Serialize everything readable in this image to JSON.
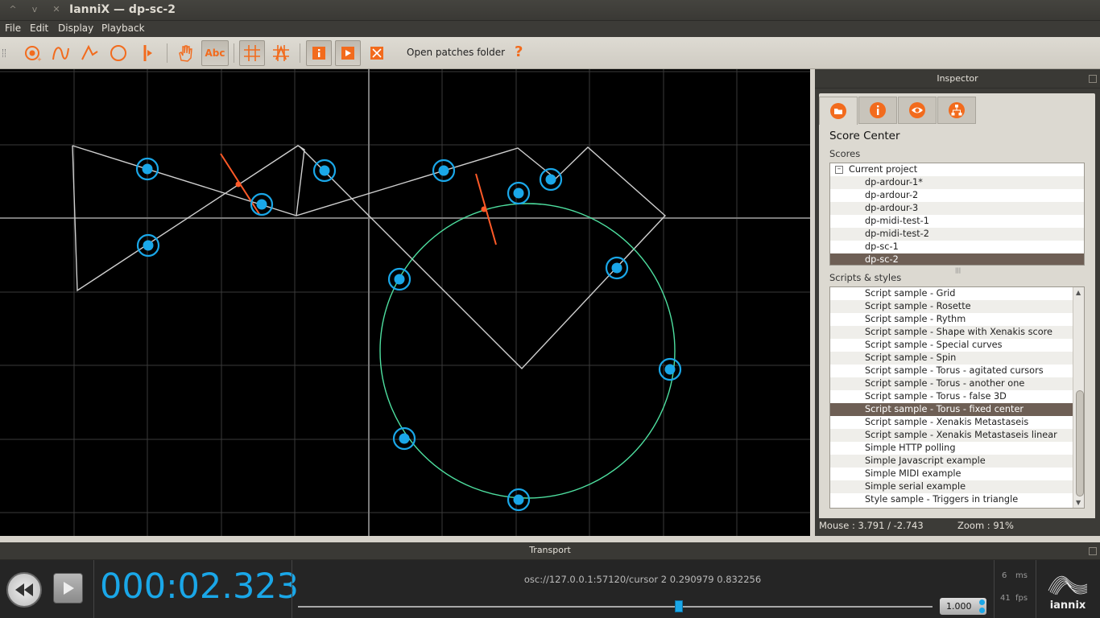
{
  "window": {
    "title": "IanniX — dp-sc-2",
    "btn_up": "^",
    "btn_down": "v",
    "btn_close": "✕"
  },
  "menu": [
    "File",
    "Edit",
    "Display",
    "Playback"
  ],
  "toolbar": {
    "open_patches": "Open patches folder",
    "help": "?",
    "text_tool": "Abc"
  },
  "inspector": {
    "title": "Inspector",
    "score_center": "Score Center",
    "scores_label": "Scores",
    "current_project": "Current project",
    "scores": [
      "dp-ardour-1*",
      "dp-ardour-2",
      "dp-ardour-3",
      "dp-midi-test-1",
      "dp-midi-test-2",
      "dp-sc-1",
      "dp-sc-2"
    ],
    "scores_selected": 6,
    "scripts_label": "Scripts & styles",
    "scripts": [
      "Script sample - Grid",
      "Script sample - Rosette",
      "Script sample - Rythm",
      "Script sample - Shape with Xenakis score",
      "Script sample - Special curves",
      "Script sample - Spin",
      "Script sample - Torus - agitated cursors",
      "Script sample - Torus - another one",
      "Script sample - Torus - false 3D",
      "Script sample - Torus - fixed center",
      "Script sample - Xenakis Metastaseis",
      "Script sample - Xenakis Metastaseis linear",
      "Simple HTTP polling",
      "Simple Javascript example",
      "Simple MIDI example",
      "Simple serial example",
      "Style sample - Triggers in triangle"
    ],
    "scripts_selected": 9,
    "mouse": "Mouse : 3.791 / -2.743",
    "zoom": "Zoom : 91%"
  },
  "transport": {
    "title": "Transport",
    "time": "000:02.323",
    "osc": "osc://127.0.0.1:57120/cursor 2 0.290979 0.832256",
    "speed": "1.000",
    "ms_value": "6",
    "ms_unit": "ms",
    "fps_value": "41",
    "fps_unit": "fps",
    "logo_text": "iannix",
    "progress": 0.6
  },
  "colors": {
    "accent_orange": "#f26b1d",
    "trigger_blue": "#1aa7e8",
    "circle_green": "#4ee0a0",
    "cursor_red": "#ff5a28",
    "time_blue": "#1aa7e8"
  }
}
